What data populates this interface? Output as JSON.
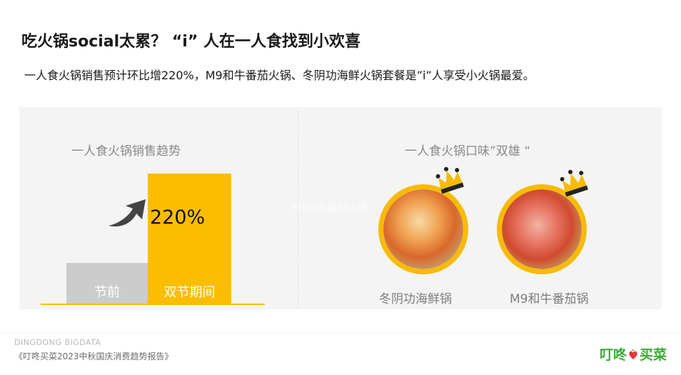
{
  "header": {
    "title": "吃火锅social太累？ “i” 人在一人食找到小欢喜",
    "subtitle": "一人食火锅销售预计环比增220%，M9和牛番茄火锅、冬阴功海鲜火锅套餐是”i”人享受小火锅最爱。"
  },
  "left_panel": {
    "title": "一人食火锅销售趋势"
  },
  "right_panel": {
    "title": "一人食火锅口味”双雄 “",
    "ghost_text": "M9和牛番茄火锅",
    "dishes": [
      {
        "label": "冬阴功海鲜锅",
        "icon": "seafood-hotpot-image"
      },
      {
        "label": "M9和牛番茄锅",
        "icon": "beef-tomato-hotpot-image"
      }
    ],
    "accent": "#f7bb05"
  },
  "chart_data": {
    "type": "bar",
    "title": "一人食火锅销售趋势",
    "categories": [
      "节前",
      "双节期间"
    ],
    "values": [
      1,
      3.2
    ],
    "annotation": "220%",
    "colors": [
      "#cccccc",
      "#fbbd00"
    ],
    "xlabel": "",
    "ylabel": ""
  },
  "footer": {
    "brand": "DINGDONG BIGDATA",
    "report": "《叮咚买菜2023中秋国庆消费趋势报告》",
    "logo_left": "叮咚",
    "logo_right": "买菜",
    "logo_color": "#3cab36"
  }
}
